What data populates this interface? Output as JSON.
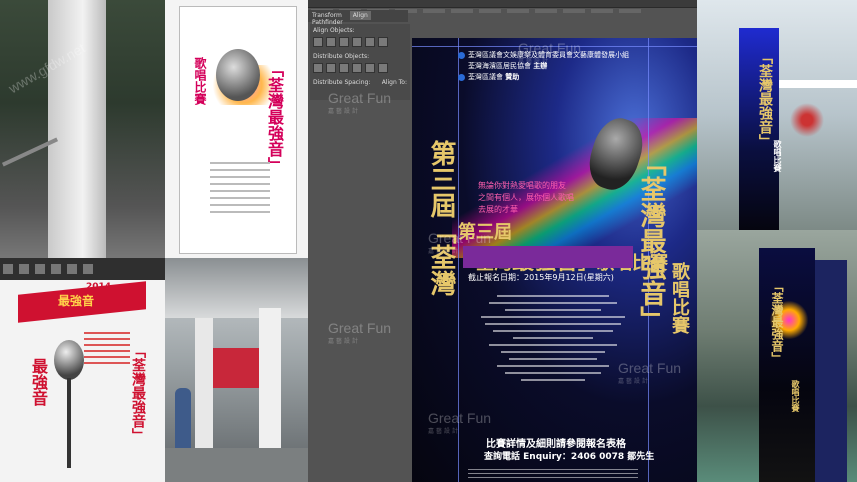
{
  "watermark": {
    "brand": "Great Fun",
    "tagline": "嘉藝設計"
  },
  "site_watermark": "www.gfdw.net",
  "software": {
    "tabs": [
      "Transform",
      "Align",
      "Pathfinder"
    ],
    "align_objects_label": "Align Objects:",
    "distribute_objects_label": "Distribute Objects:",
    "distribute_spacing_label": "Distribute Spacing:",
    "align_to_label": "Align To:"
  },
  "poster": {
    "organizers": [
      "荃灣區議會文娛康樂及體育委員會文藝康體發展小組",
      "荃灣海濱區居民協會"
    ],
    "organizer_role": "主辦",
    "sponsor": "荃灣區議會",
    "sponsor_role": "贊助",
    "edition": "第三屆",
    "title_open": "「荃灣",
    "title_main": "最強音",
    "title_close": "」",
    "subtitle": "歌唱比賽",
    "slogan_lines": [
      "無論你對熱愛唱歌的朋友",
      "之間有個人，展你個人歌唱",
      "去展的才華"
    ],
    "deadline": "截止報名日期：2015年9月12日(星期六)",
    "enquiry_heading": "比賽詳情及細則請參閱報名表格",
    "enquiry": "查詢電話 Enquiry：2406 0078 鄒先生"
  },
  "small_poster": {
    "title": "「荃灣最強音」",
    "subtitle": "歌唱比賽"
  },
  "red_poster": {
    "year": "2014",
    "title": "最強音"
  },
  "pillar": {
    "title": "「荃灣最強音」",
    "subtitle": "歌唱比賽"
  }
}
